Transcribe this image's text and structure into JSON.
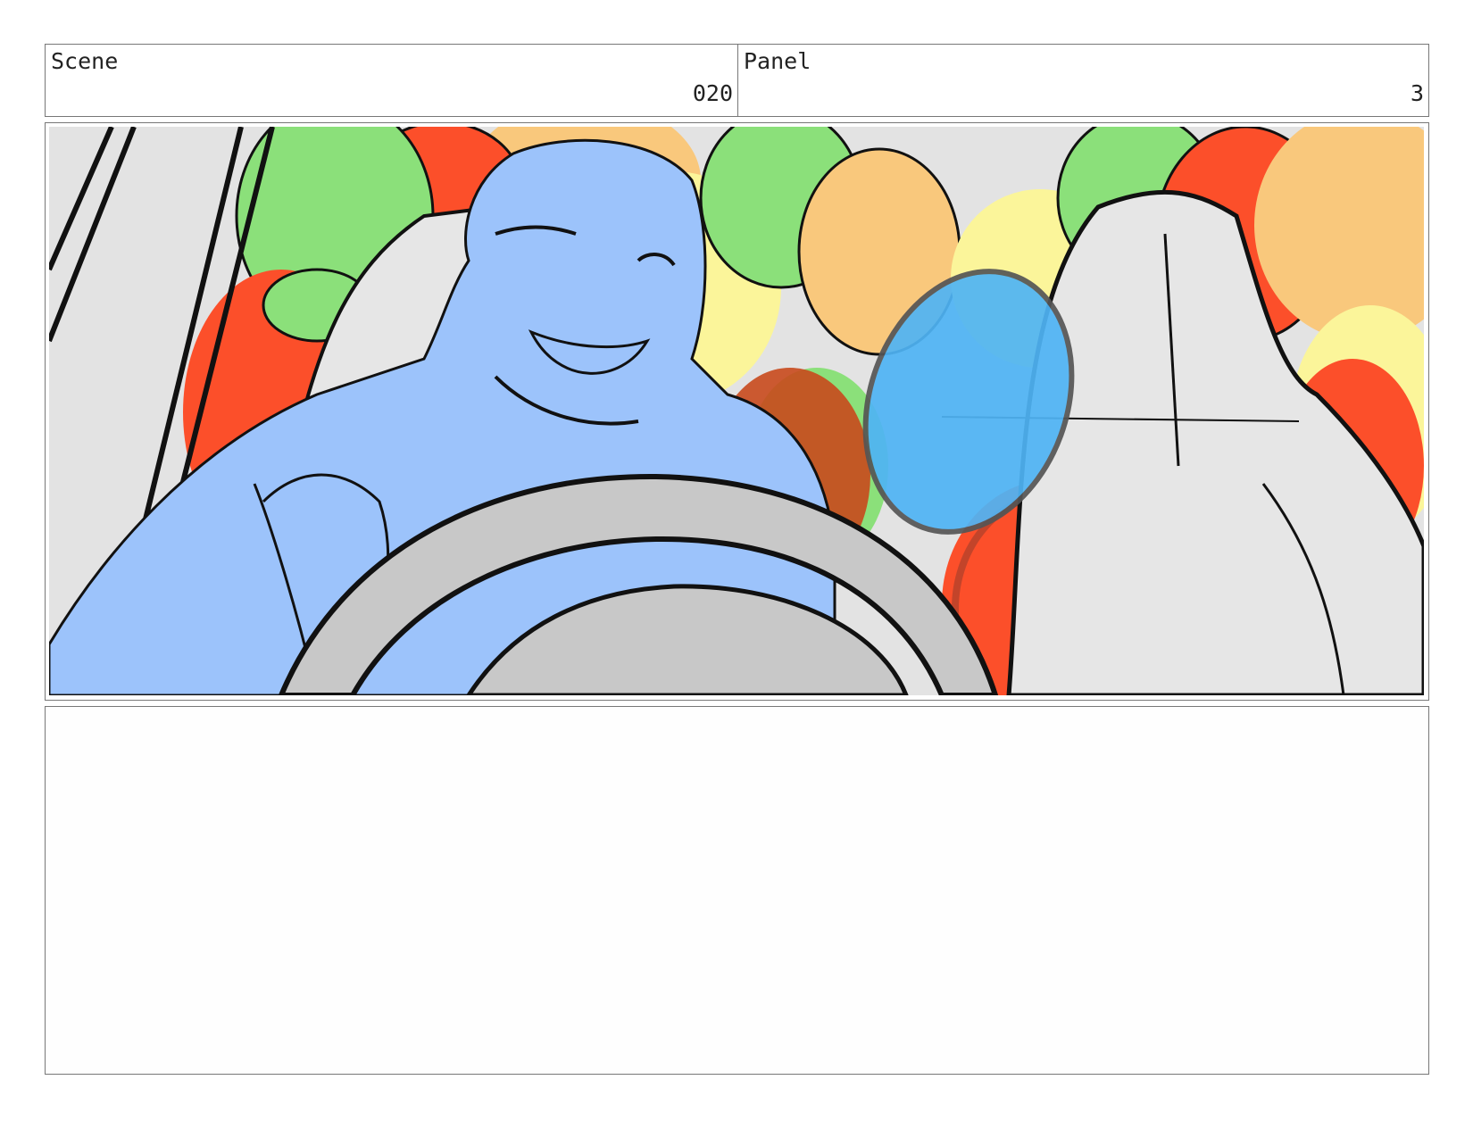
{
  "header": {
    "scene_label": "Scene",
    "scene_number": "020",
    "panel_label": "Panel",
    "panel_number": "3"
  },
  "storyboard_image": {
    "icon": "sketch-image",
    "description_colors": {
      "background": "#e3e3e3",
      "figure": "#9cc3fb",
      "green": "#8be07a",
      "red": "#fc4f2a",
      "orange": "#f9c87c",
      "yellow": "#fbf59a",
      "blue": "#4fb4f5",
      "wheel": "#c8c8c8"
    }
  },
  "notes": {
    "text": ""
  }
}
